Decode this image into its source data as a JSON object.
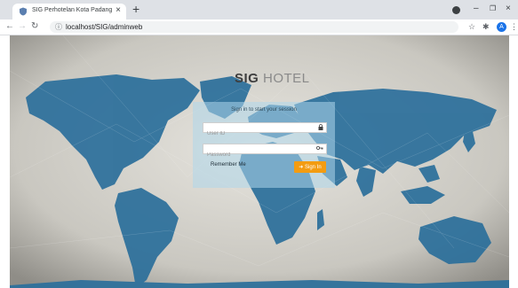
{
  "browser": {
    "tab_title": "SIG Perhotelan Kota Padang",
    "tab_close": "×",
    "new_tab": "+",
    "url": "localhost/SIG/adminweb",
    "profile_initial": "A",
    "window_buttons": [
      "–",
      "❐",
      "×"
    ],
    "nav": {
      "back": "←",
      "forward": "→",
      "reload": "↻"
    },
    "toolbar_icons": {
      "star": "☆",
      "extensions": "✱",
      "menu": "⋮"
    }
  },
  "login": {
    "brand_bold": "SIG",
    "brand_light": " HOTEL",
    "signin_note": "Sign in to start your session",
    "userid_placeholder": "User ID",
    "password_placeholder": "Password",
    "remember_label": "Remember Me",
    "signin_button": "Sign In",
    "signin_icon": "➜"
  },
  "icons": {
    "lock": "lock-icon",
    "key": "key-icon"
  },
  "colors": {
    "accent": "#f39c12",
    "panel": "#afd7eb",
    "map_ocean_dark": "#1c4e7a",
    "map_land": "#2e7ba8"
  }
}
